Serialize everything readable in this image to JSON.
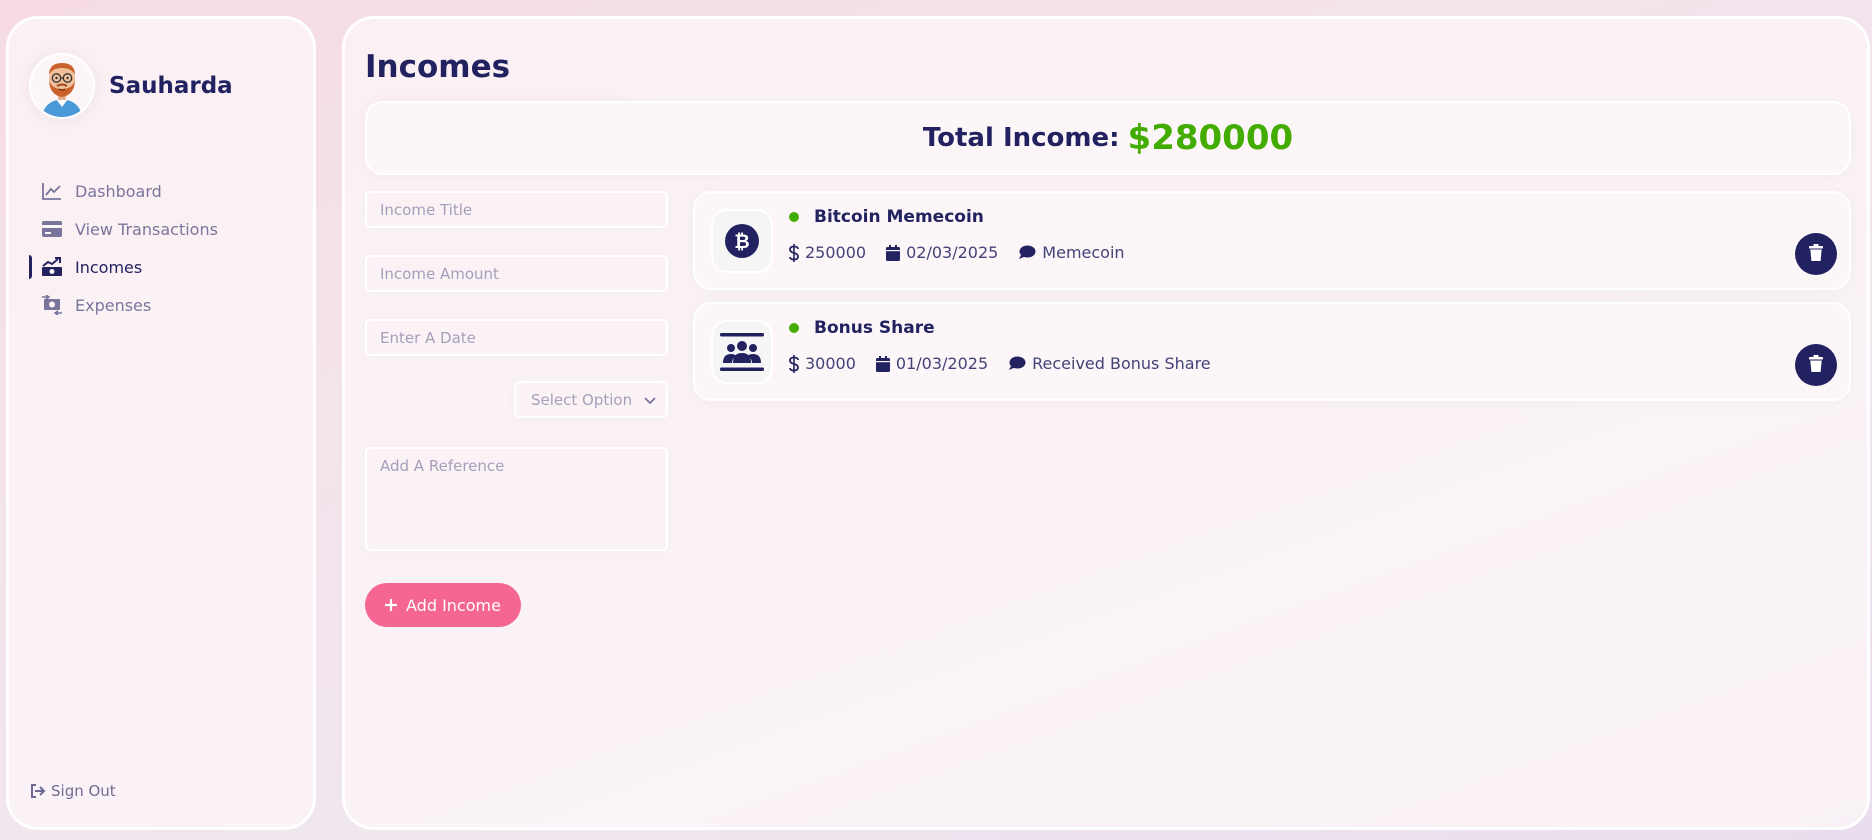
{
  "user": {
    "name": "Sauharda"
  },
  "nav": {
    "items": [
      {
        "label": "Dashboard",
        "icon": "chart-line-icon"
      },
      {
        "label": "View Transactions",
        "icon": "credit-card-icon"
      },
      {
        "label": "Incomes",
        "icon": "money-bill-trend-up-icon"
      },
      {
        "label": "Expenses",
        "icon": "money-bill-transfer-icon"
      }
    ],
    "active_index": 2,
    "signout_label": "Sign Out"
  },
  "page": {
    "title": "Incomes",
    "total_label": "Total Income:",
    "total_amount": "$280000"
  },
  "form": {
    "title_placeholder": "Income Title",
    "amount_placeholder": "Income Amount",
    "date_placeholder": "Enter A Date",
    "select_placeholder": "Select Option",
    "reference_placeholder": "Add A Reference",
    "add_label": "Add Income"
  },
  "incomes": [
    {
      "title": "Bitcoin Memecoin",
      "amount": "250000",
      "date": "02/03/2025",
      "description": "Memecoin",
      "icon": "bitcoin-icon"
    },
    {
      "title": "Bonus Share",
      "amount": "30000",
      "date": "01/03/2025",
      "description": "Received Bonus Share",
      "icon": "users-rectangle-icon"
    }
  ],
  "colors": {
    "primary": "#222260",
    "accent_green": "#42ad00",
    "button_pink": "#f56692"
  }
}
